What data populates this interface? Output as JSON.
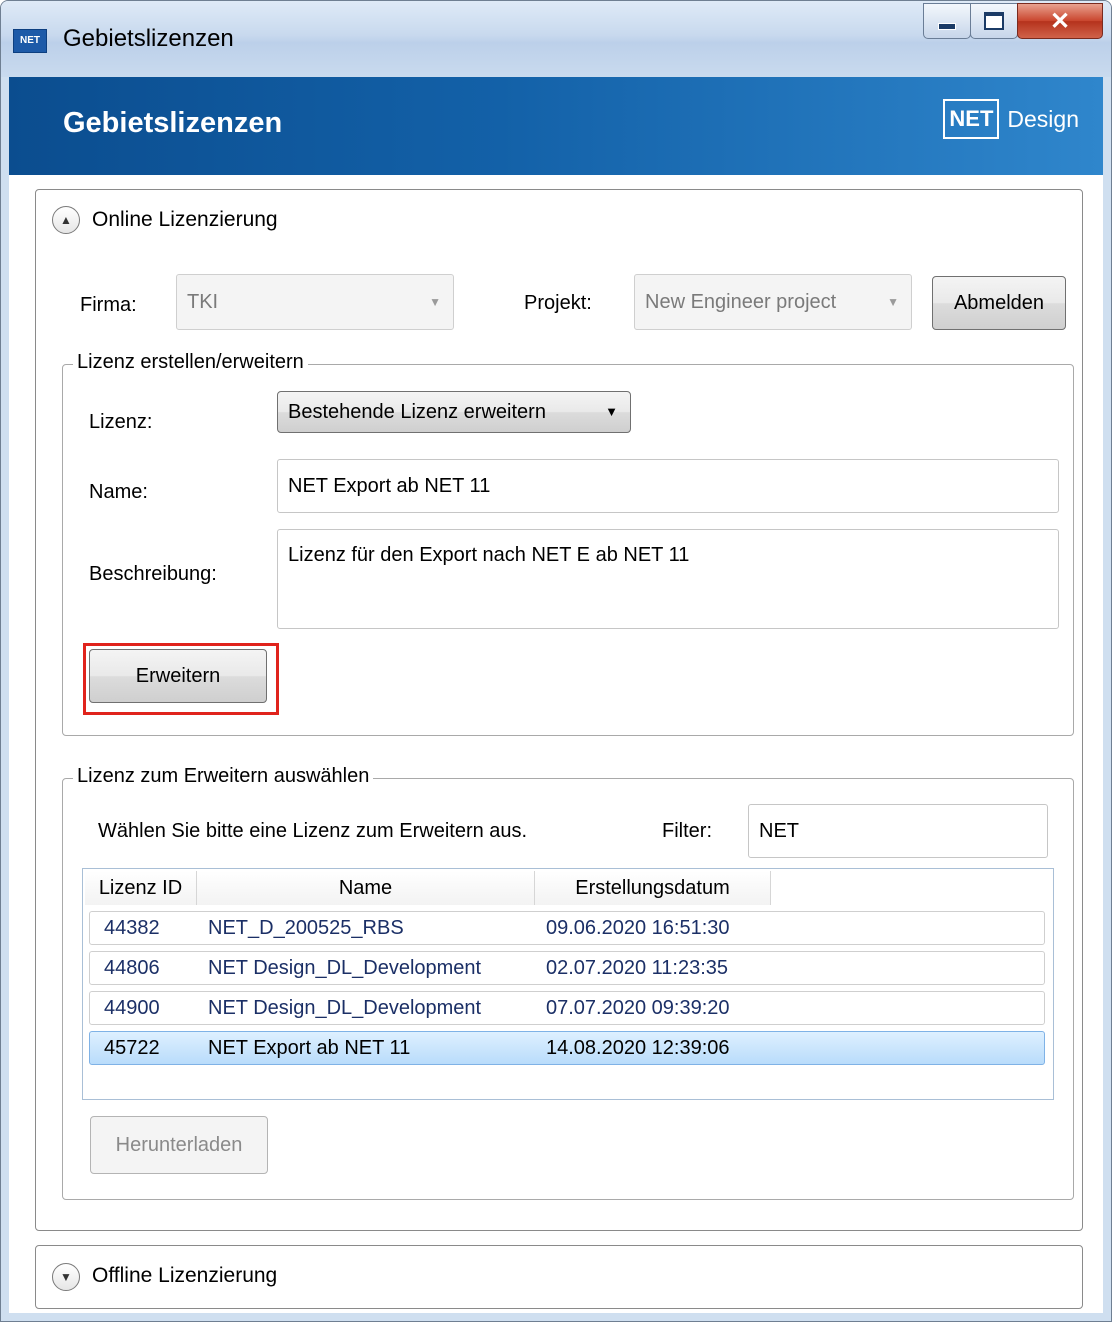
{
  "window": {
    "title": "Gebietslizenzen",
    "app_icon": "NET"
  },
  "header": {
    "title": "Gebietslizenzen",
    "logo_box": "NET",
    "logo_word": "Design"
  },
  "online": {
    "label": "Online Lizenzierung",
    "firma_label": "Firma:",
    "firma_value": "TKI",
    "projekt_label": "Projekt:",
    "projekt_value": "New Engineer project",
    "abmelden": "Abmelden",
    "create_group": {
      "title": "Lizenz erstellen/erweitern",
      "lizenz_label": "Lizenz:",
      "lizenz_value": "Bestehende Lizenz erweitern",
      "name_label": "Name:",
      "name_value": "NET Export ab NET 11",
      "beschreibung_label": "Beschreibung:",
      "beschreibung_value": "Lizenz für den Export nach NET E ab NET 11",
      "erweitern": "Erweitern"
    },
    "select_group": {
      "title": "Lizenz zum Erweitern auswählen",
      "hint": "Wählen Sie bitte eine Lizenz zum Erweitern aus.",
      "filter_label": "Filter:",
      "filter_value": "NET",
      "columns": [
        "Lizenz ID",
        "Name",
        "Erstellungsdatum"
      ],
      "rows": [
        {
          "id": "44382",
          "name": "NET_D_200525_RBS",
          "date": "09.06.2020 16:51:30",
          "selected": false
        },
        {
          "id": "44806",
          "name": "NET Design_DL_Development",
          "date": "02.07.2020 11:23:35",
          "selected": false
        },
        {
          "id": "44900",
          "name": "NET Design_DL_Development",
          "date": "07.07.2020 09:39:20",
          "selected": false
        },
        {
          "id": "45722",
          "name": "NET Export ab NET 11",
          "date": "14.08.2020 12:39:06",
          "selected": true
        }
      ],
      "herunterladen": "Herunterladen"
    }
  },
  "offline": {
    "label": "Offline Lizenzierung"
  },
  "colors": {
    "header_start": "#0b4d8f",
    "header_end": "#2f86cc",
    "highlight": "#e0231c",
    "selection": "#b9dcfb"
  }
}
